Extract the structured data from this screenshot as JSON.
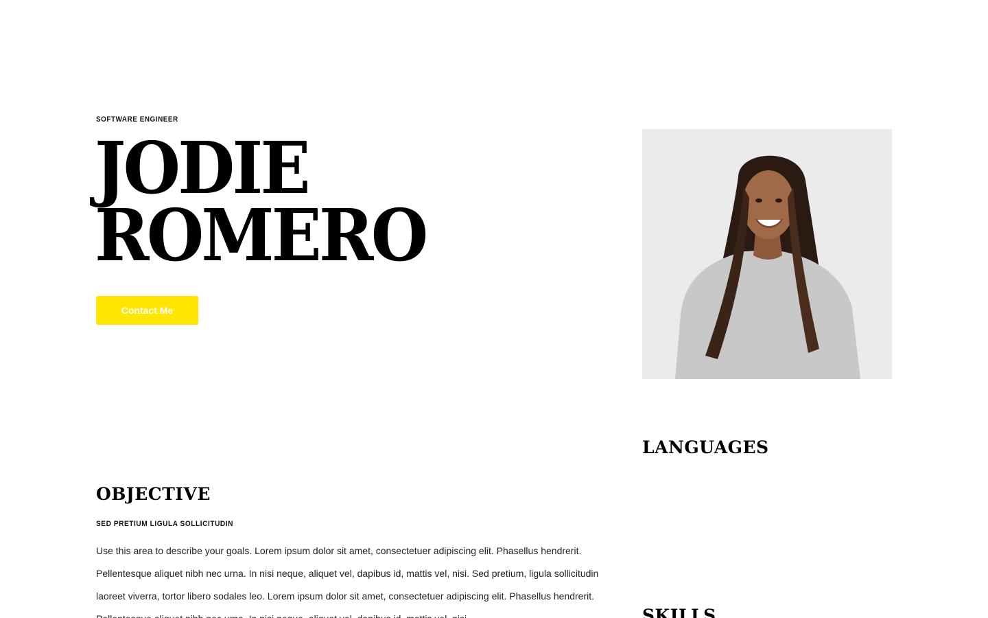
{
  "hero": {
    "eyebrow": "SOFTWARE ENGINEER",
    "first_name": "JODIE",
    "last_name": "ROMERO",
    "contact_label": "Contact Me",
    "accent_color": "#ffe600"
  },
  "portrait": {
    "background_color": "#ebebeb",
    "sweater_color": "#c8c8c8",
    "hair_color": "#2a1a12"
  },
  "objective": {
    "heading": "OBJECTIVE",
    "subheading": "SED PRETIUM LIGULA SOLLICITUDIN",
    "body": "Use this area to describe your goals. Lorem ipsum dolor sit amet, consectetuer adipiscing elit. Phasellus hendrerit. Pellentesque aliquet nibh nec urna. In nisi neque, aliquet vel, dapibus id, mattis vel, nisi. Sed pretium, ligula sollicitudin laoreet viverra, tortor libero sodales leo. Lorem ipsum dolor sit amet, consectetuer adipiscing elit. Phasellus hendrerit. Pellentesque aliquet nibh nec urna. In nisi neque, aliquet vel, dapibus id, mattis vel, nisi."
  },
  "sidebar": {
    "languages_heading": "LANGUAGES",
    "skills_heading": "SKILLS"
  }
}
